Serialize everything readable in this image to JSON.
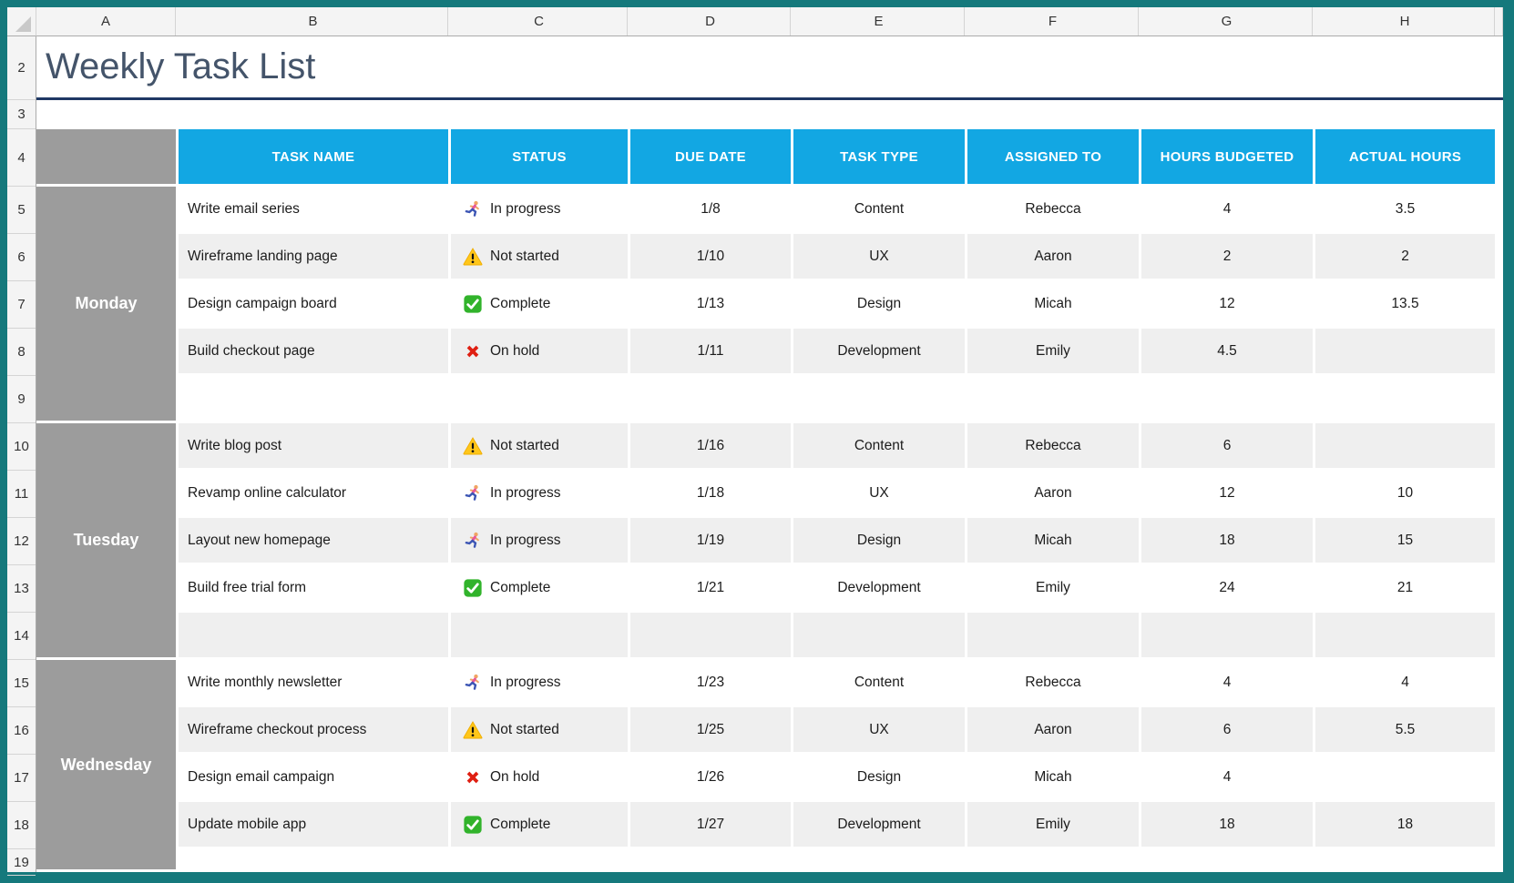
{
  "spreadsheet": {
    "column_letters": [
      "A",
      "B",
      "C",
      "D",
      "E",
      "F",
      "G",
      "H"
    ],
    "row_numbers": [
      "2",
      "3",
      "4",
      "5",
      "6",
      "7",
      "8",
      "9",
      "10",
      "11",
      "12",
      "13",
      "14",
      "15",
      "16",
      "17",
      "18",
      "19"
    ],
    "title": "Weekly Task List",
    "colors": {
      "header_blue": "#12A7E3",
      "day_gray": "#9C9C9C",
      "band_gray": "#EFEFEF",
      "title_text": "#44546A",
      "title_underline": "#1F3864",
      "frame_teal": "#15797C"
    },
    "table": {
      "headers": [
        "TASK NAME",
        "STATUS",
        "DUE DATE",
        "TASK TYPE",
        "ASSIGNED TO",
        "HOURS BUDGETED",
        "ACTUAL HOURS"
      ],
      "groups": [
        {
          "day": "Monday",
          "rows": [
            {
              "task": "Write email series",
              "status": {
                "icon": "in-progress",
                "label": "In progress"
              },
              "due": "1/8",
              "type": "Content",
              "assigned": "Rebecca",
              "hours_budgeted": "4",
              "actual_hours": "3.5"
            },
            {
              "task": "Wireframe landing page",
              "status": {
                "icon": "not-started",
                "label": "Not started"
              },
              "due": "1/10",
              "type": "UX",
              "assigned": "Aaron",
              "hours_budgeted": "2",
              "actual_hours": "2"
            },
            {
              "task": "Design campaign board",
              "status": {
                "icon": "complete",
                "label": "Complete"
              },
              "due": "1/13",
              "type": "Design",
              "assigned": "Micah",
              "hours_budgeted": "12",
              "actual_hours": "13.5"
            },
            {
              "task": "Build checkout page",
              "status": {
                "icon": "on-hold",
                "label": "On hold"
              },
              "due": "1/11",
              "type": "Development",
              "assigned": "Emily",
              "hours_budgeted": "4.5",
              "actual_hours": ""
            }
          ]
        },
        {
          "day": "Tuesday",
          "rows": [
            {
              "task": "Write blog post",
              "status": {
                "icon": "not-started",
                "label": "Not started"
              },
              "due": "1/16",
              "type": "Content",
              "assigned": "Rebecca",
              "hours_budgeted": "6",
              "actual_hours": ""
            },
            {
              "task": "Revamp online calculator",
              "status": {
                "icon": "in-progress",
                "label": "In progress"
              },
              "due": "1/18",
              "type": "UX",
              "assigned": "Aaron",
              "hours_budgeted": "12",
              "actual_hours": "10"
            },
            {
              "task": "Layout new homepage",
              "status": {
                "icon": "in-progress",
                "label": "In progress"
              },
              "due": "1/19",
              "type": "Design",
              "assigned": "Micah",
              "hours_budgeted": "18",
              "actual_hours": "15"
            },
            {
              "task": "Build free trial form",
              "status": {
                "icon": "complete",
                "label": "Complete"
              },
              "due": "1/21",
              "type": "Development",
              "assigned": "Emily",
              "hours_budgeted": "24",
              "actual_hours": "21"
            }
          ]
        },
        {
          "day": "Wednesday",
          "rows": [
            {
              "task": "Write monthly newsletter",
              "status": {
                "icon": "in-progress",
                "label": "In progress"
              },
              "due": "1/23",
              "type": "Content",
              "assigned": "Rebecca",
              "hours_budgeted": "4",
              "actual_hours": "4"
            },
            {
              "task": "Wireframe checkout process",
              "status": {
                "icon": "not-started",
                "label": "Not started"
              },
              "due": "1/25",
              "type": "UX",
              "assigned": "Aaron",
              "hours_budgeted": "6",
              "actual_hours": "5.5"
            },
            {
              "task": "Design email campaign",
              "status": {
                "icon": "on-hold",
                "label": "On hold"
              },
              "due": "1/26",
              "type": "Design",
              "assigned": "Micah",
              "hours_budgeted": "4",
              "actual_hours": ""
            },
            {
              "task": "Update mobile app",
              "status": {
                "icon": "complete",
                "label": "Complete"
              },
              "due": "1/27",
              "type": "Development",
              "assigned": "Emily",
              "hours_budgeted": "18",
              "actual_hours": "18"
            }
          ]
        }
      ]
    }
  }
}
